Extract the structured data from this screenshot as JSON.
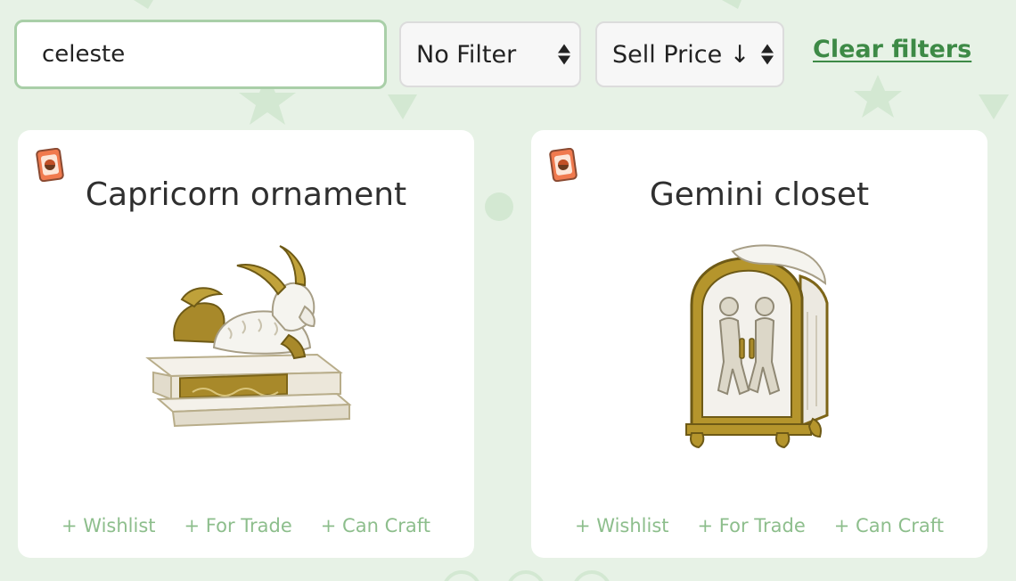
{
  "search": {
    "value": "celeste"
  },
  "filter_select": {
    "selected": "No Filter"
  },
  "sort_select": {
    "selected": "Sell Price ↓"
  },
  "clear_filters_label": "Clear filters",
  "cards": [
    {
      "title": "Capricorn ornament",
      "actions": {
        "wishlist": "+ Wishlist",
        "for_trade": "+ For Trade",
        "can_craft": "+ Can Craft"
      }
    },
    {
      "title": "Gemini closet",
      "actions": {
        "wishlist": "+ Wishlist",
        "for_trade": "+ For Trade",
        "can_craft": "+ Can Craft"
      }
    }
  ],
  "colors": {
    "background": "#e7f2e6",
    "accent": "#3d8a46",
    "action_text": "#8dbe8c",
    "input_border": "#a9cfa8"
  }
}
